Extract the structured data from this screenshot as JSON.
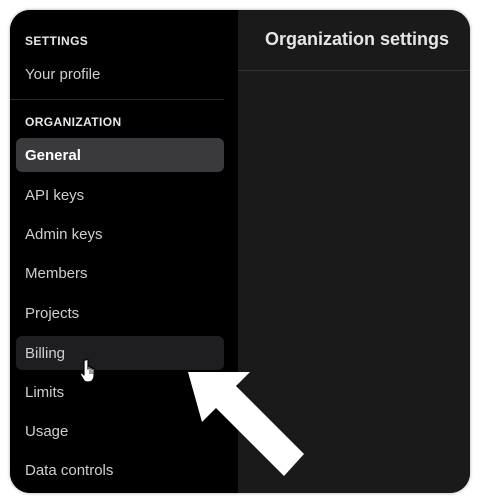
{
  "sidebar": {
    "settings_header": "SETTINGS",
    "your_profile": "Your profile",
    "organization_header": "ORGANIZATION",
    "items": [
      {
        "label": "General",
        "state": "active"
      },
      {
        "label": "API keys"
      },
      {
        "label": "Admin keys"
      },
      {
        "label": "Members"
      },
      {
        "label": "Projects"
      },
      {
        "label": "Billing",
        "state": "hover"
      },
      {
        "label": "Limits"
      },
      {
        "label": "Usage"
      },
      {
        "label": "Data controls"
      }
    ]
  },
  "main": {
    "title": "Organization settings"
  },
  "overlay": {
    "cursor_icon": "hand-pointer-icon",
    "annotation_icon": "arrow-up-left-icon"
  },
  "colors": {
    "sidebar_bg": "#000000",
    "main_bg": "#1a1a1a",
    "active_item_bg": "#3a3a3c",
    "hover_item_bg": "#1e1e20",
    "arrow": "#ffffff"
  }
}
